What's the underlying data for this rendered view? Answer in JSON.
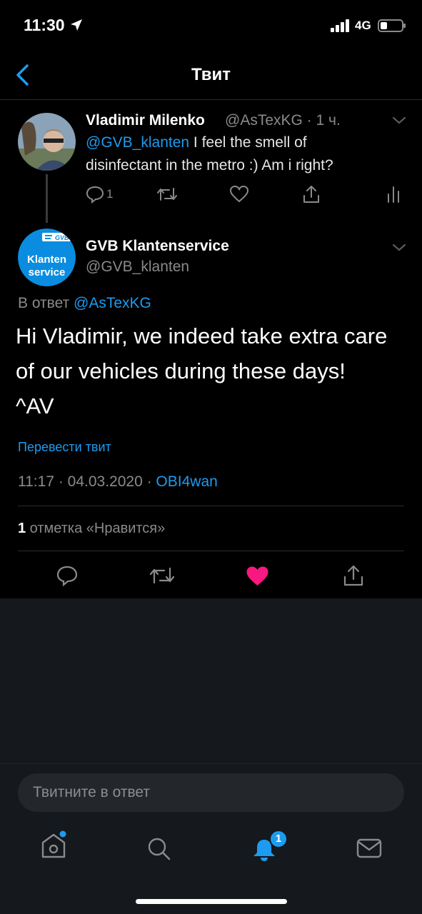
{
  "status_bar": {
    "time": "11:30",
    "network": "4G"
  },
  "nav": {
    "title": "Твит"
  },
  "parent_tweet": {
    "name": "Vladimir Milenko",
    "handle_time": "@AsTexKG · 1 ч.",
    "mention": "@GVB_klanten",
    "text_line1": " I feel the smell of",
    "text_line2": "disinfectant in the metro :) Am i right?",
    "reply_count": "1"
  },
  "main_tweet": {
    "name": "GVB Klantenservice",
    "handle": "@GVB_klanten",
    "avatar_brand": "GVB",
    "avatar_line1": "Klanten",
    "avatar_line2": "service",
    "reply_prefix": "В ответ ",
    "reply_to": "@AsTexKG",
    "text_line1": "Hi Vladimir, we indeed take extra care",
    "text_line2": "of our vehicles during these days!",
    "text_line3": "^AV",
    "translate": "Перевести твит",
    "timestamp": "11:17 · 04.03.2020 · ",
    "source": "OBI4wan",
    "likes_count": "1",
    "likes_label": " отметка «Нравится»"
  },
  "reply_input": {
    "placeholder": "Твитните в ответ"
  },
  "tab_bar": {
    "notifications_badge": "1"
  },
  "colors": {
    "accent": "#1d9bf0",
    "like": "#f91880",
    "background": "#000000",
    "lower_background": "#15181c"
  }
}
